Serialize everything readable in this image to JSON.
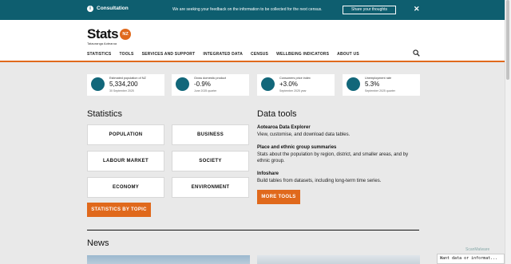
{
  "banner": {
    "title": "Consultation",
    "message": "We are seeking your feedback on the information to be collected for the next census.",
    "share_label": "Share your thoughts",
    "close_glyph": "✕",
    "info_glyph": "i"
  },
  "header": {
    "logo_text": "Stats",
    "logo_badge": "NZ",
    "logo_sub": "Tatauranga Aotearoa",
    "nav": [
      "STATISTICS",
      "TOOLS",
      "SERVICES AND SUPPORT",
      "INTEGRATED DATA",
      "CENSUS",
      "WELLBEING INDICATORS",
      "ABOUT US"
    ]
  },
  "indicators": [
    {
      "label": "Estimated population of NZ",
      "value": "5,334,200",
      "date": "30 September 2025"
    },
    {
      "label": "Gross domestic product",
      "value": "-0.9%",
      "date": "June 2025 quarter"
    },
    {
      "label": "Consumers price index",
      "value": "+3.0%",
      "date": "September 2025 year"
    },
    {
      "label": "Unemployment rate",
      "value": "5.3%",
      "date": "September 2025 quarter"
    }
  ],
  "statistics": {
    "heading": "Statistics",
    "buttons": [
      "POPULATION",
      "BUSINESS",
      "LABOUR MARKET",
      "SOCIETY",
      "ECONOMY",
      "ENVIRONMENT"
    ],
    "by_topic_label": "STATISTICS BY TOPIC"
  },
  "data_tools": {
    "heading": "Data tools",
    "items": [
      {
        "title": "Aotearoa Data Explorer",
        "desc": "View, customise, and download data tables."
      },
      {
        "title": "Place and ethnic group summaries",
        "desc": "Stats about the population by region, district, and smaller areas, and by ethnic group."
      },
      {
        "title": "Infoshare",
        "desc": "Build tables from datasets, including long-term time series."
      }
    ],
    "more_label": "MORE TOOLS"
  },
  "news": {
    "heading": "News"
  },
  "overlay": {
    "want_text": "Want data or informat...",
    "scanmalware": "ScanMalware"
  },
  "colors": {
    "banner": "#0e5e6f",
    "accent": "#e0691c",
    "icon": "#12677a",
    "background": "#e9e9e9"
  }
}
